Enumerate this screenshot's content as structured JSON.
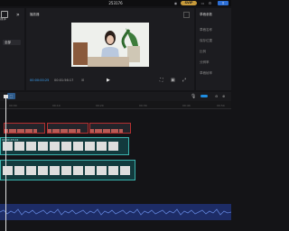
{
  "window": {
    "title": "253176",
    "vip_label": "SVIP"
  },
  "left_panel": {
    "media_label": "媒体",
    "button_label": "全部"
  },
  "player": {
    "title": "播放器",
    "current_time": "00:00:00:25",
    "total_time": "00:01:56:17"
  },
  "right_panel": {
    "title": "草稿参数",
    "items": [
      "草稿名称",
      "保存位置",
      "比例",
      "分辨率",
      "草稿帧率"
    ]
  },
  "timeline": {
    "ruler_ticks": [
      "00:00",
      "00:10",
      "00:20",
      "00:30",
      "00:40",
      "00:50"
    ],
    "text_track_color": "#b43030",
    "video_track_label": "00:00:45:04",
    "video_track_color": "#3bb3ad",
    "audio_track_color": "#1d2c66"
  },
  "colors": {
    "accent": "#3aa7ff",
    "vip": "#c79a3a"
  }
}
